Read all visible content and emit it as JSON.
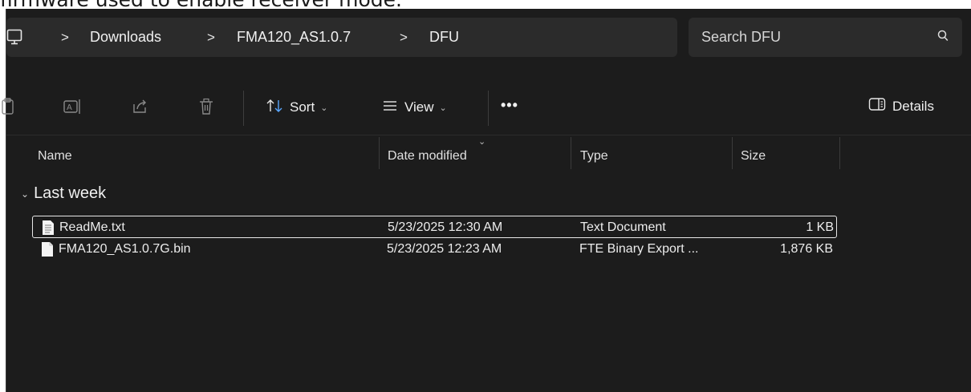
{
  "page_text": "firmware used to enable receiver mode.",
  "address": {
    "crumbs": [
      "Downloads",
      "FMA120_AS1.0.7",
      "DFU"
    ],
    "separator": ">"
  },
  "search": {
    "placeholder": "Search DFU"
  },
  "toolbar": {
    "sort_label": "Sort",
    "view_label": "View",
    "more_label": "•••",
    "details_label": "Details"
  },
  "columns": {
    "name": "Name",
    "date": "Date modified",
    "type": "Type",
    "size": "Size"
  },
  "group": {
    "label": "Last week"
  },
  "files": [
    {
      "name": "ReadMe.txt",
      "date": "5/23/2025 12:30 AM",
      "type": "Text Document",
      "size": "1 KB",
      "selected": true,
      "icon": "text-file-icon"
    },
    {
      "name": "FMA120_AS1.0.7G.bin",
      "date": "5/23/2025 12:23 AM",
      "type": "FTE Binary Export ...",
      "size": "1,876 KB",
      "selected": false,
      "icon": "blank-file-icon"
    }
  ],
  "colors": {
    "background": "#1c1c1c",
    "panel": "#2b2b2b",
    "text": "#f0f0f0"
  }
}
